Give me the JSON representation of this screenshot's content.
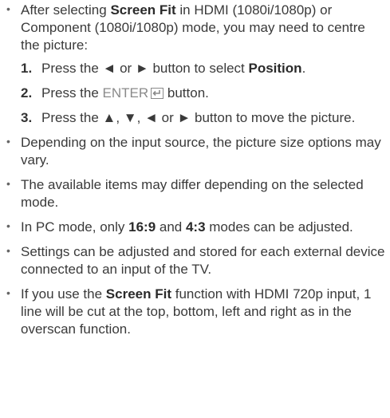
{
  "notes": [
    {
      "parts": [
        {
          "t": "After selecting ",
          "b": false
        },
        {
          "t": "Screen Fit",
          "b": true
        },
        {
          "t": " in HDMI (1080i/1080p) or Component (1080i/1080p) mode, you may need to centre the picture:",
          "b": false
        }
      ],
      "steps": [
        {
          "num": "1.",
          "parts": [
            {
              "t": "Press the ◄ or ► button to select ",
              "b": false
            },
            {
              "t": "Position",
              "b": true
            },
            {
              "t": ".",
              "b": false
            }
          ]
        },
        {
          "num": "2.",
          "press": "Press the ",
          "enter_label": "ENTER",
          "after": " button."
        },
        {
          "num": "3.",
          "parts": [
            {
              "t": "Press the ▲, ▼, ◄ or ► button to move the picture.",
              "b": false
            }
          ]
        }
      ]
    },
    {
      "parts": [
        {
          "t": "Depending on the input source, the picture size options may vary.",
          "b": false
        }
      ]
    },
    {
      "parts": [
        {
          "t": "The available items may differ depending on the selected mode.",
          "b": false
        }
      ]
    },
    {
      "parts": [
        {
          "t": "In PC mode, only ",
          "b": false
        },
        {
          "t": "16:9",
          "b": true
        },
        {
          "t": " and ",
          "b": false
        },
        {
          "t": "4:3",
          "b": true
        },
        {
          "t": " modes can be adjusted.",
          "b": false
        }
      ]
    },
    {
      "parts": [
        {
          "t": "Settings can be adjusted and stored for each external device connected to an input of the TV.",
          "b": false
        }
      ]
    },
    {
      "parts": [
        {
          "t": "If you use the ",
          "b": false
        },
        {
          "t": "Screen Fit",
          "b": true
        },
        {
          "t": " function with HDMI 720p input, 1 line will be cut at the top, bottom, left and right as in the overscan function.",
          "b": false
        }
      ]
    }
  ],
  "icons": {
    "bullet": "bullet-dot",
    "enter": "enter-key-icon"
  }
}
